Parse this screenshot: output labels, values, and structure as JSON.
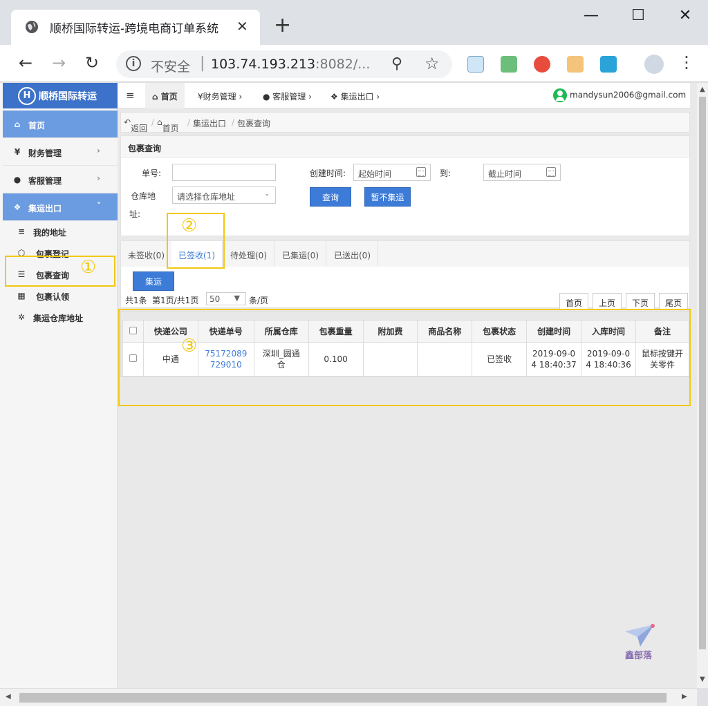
{
  "browser": {
    "tab_title": "顺桥国际转运-跨境电商订单系统",
    "security_label": "不安全",
    "url_host": "103.74.193.213",
    "url_rest": ":8082/..."
  },
  "sidebar": {
    "brand": "顺桥国际转运",
    "items": [
      {
        "label": "首页",
        "icon": "home-icon"
      },
      {
        "label": "财务管理",
        "icon": "yen-icon"
      },
      {
        "label": "客服管理",
        "icon": "user-icon"
      },
      {
        "label": "集运出口",
        "icon": "cubes-icon"
      }
    ],
    "sub_items": [
      {
        "label": "我的地址",
        "icon": "list-icon"
      },
      {
        "label": "包裹登记",
        "icon": "box-icon"
      },
      {
        "label": "包裹查询",
        "icon": "align-icon"
      },
      {
        "label": "包裹认领",
        "icon": "grid-icon"
      },
      {
        "label": "集运仓库地址",
        "icon": "gear-icon"
      }
    ]
  },
  "topnav": {
    "home": "首页",
    "finance": "¥财务管理",
    "service": "客服管理",
    "consolidation": "集运出口",
    "user_email": "mandysun2006@gmail.com"
  },
  "breadcrumb": {
    "back": "返回",
    "home": "首页",
    "section": "集运出口",
    "current": "包裹查询"
  },
  "search_panel": {
    "title": "包裹查询",
    "order_no_label": "单号:",
    "order_no_value": "",
    "created_label": "创建时间:",
    "start_placeholder": "起始时间",
    "to_label": "到:",
    "end_placeholder": "截止时间",
    "warehouse_label_1": "仓库地",
    "warehouse_label_2": "址:",
    "warehouse_selected": "请选择仓库地址",
    "query_button": "查询",
    "hold_button": "暂不集运"
  },
  "tabs": [
    {
      "label": "未签收(0)"
    },
    {
      "label": "已签收(1)"
    },
    {
      "label": "待处理(0)"
    },
    {
      "label": "已集运(0)"
    },
    {
      "label": "已送出(0)"
    }
  ],
  "actions": {
    "consolidate_button": "集运"
  },
  "pager": {
    "total": "共1条",
    "page_info": "第1页/共1页",
    "page_size": "50",
    "per_page_unit": "条/页",
    "first": "首页",
    "prev": "上页",
    "next": "下页",
    "last": "尾页"
  },
  "table": {
    "headers": [
      "快递公司",
      "快递单号",
      "所属仓库",
      "包裹重量",
      "附加费",
      "商品名称",
      "包裹状态",
      "创建时间",
      "入库时间",
      "备注"
    ],
    "rows": [
      {
        "courier": "中通",
        "tracking_1": "75172089",
        "tracking_2": "729010",
        "warehouse_1": "深圳_圆通",
        "warehouse_2": "仓",
        "weight": "0.100",
        "surcharge": "",
        "product": "",
        "status": "已签收",
        "created_1": "2019-09-0",
        "created_2": "4 18:40:37",
        "stored_1": "2019-09-0",
        "stored_2": "4 18:40:36",
        "remark_1": "鼠标按键开",
        "remark_2": "关零件"
      }
    ]
  },
  "annotations": [
    "①",
    "②",
    "③"
  ],
  "watermark": "鑫部落",
  "colors": {
    "accent": "#3c7bd8",
    "highlight": "#f2c811",
    "sidebar_active": "#6b9be0"
  }
}
